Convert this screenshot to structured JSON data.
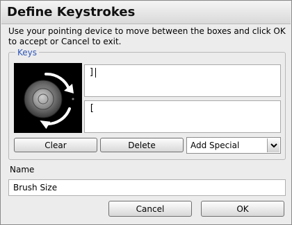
{
  "dialog": {
    "title": "Define Keystrokes",
    "instructions": "Use your pointing device to move between the boxes and click OK to accept or Cancel to exit."
  },
  "keys": {
    "legend": "Keys",
    "icon": "touch-ring-rotate-icon",
    "top_value": "]",
    "bottom_value": "[",
    "clear_label": "Clear",
    "delete_label": "Delete",
    "special_selected": "Add Special"
  },
  "name": {
    "label": "Name",
    "value": "Brush Size"
  },
  "actions": {
    "cancel_label": "Cancel",
    "ok_label": "OK"
  }
}
